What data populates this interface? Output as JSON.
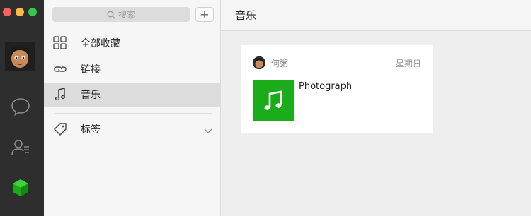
{
  "sidebar": {
    "search_placeholder": "搜索",
    "add_label": "+",
    "items": [
      {
        "label": "全部收藏",
        "icon": "grid-icon"
      },
      {
        "label": "链接",
        "icon": "link-icon"
      },
      {
        "label": "音乐",
        "icon": "music-note-icon",
        "active": true
      },
      {
        "label": "标签",
        "icon": "tag-icon"
      }
    ]
  },
  "header": {
    "title": "音乐"
  },
  "card": {
    "sender": "何粥",
    "date": "星期日",
    "song_title": "Photograph"
  },
  "colors": {
    "accent_green": "#1aad19",
    "rail_bg": "#2e2e2e"
  }
}
